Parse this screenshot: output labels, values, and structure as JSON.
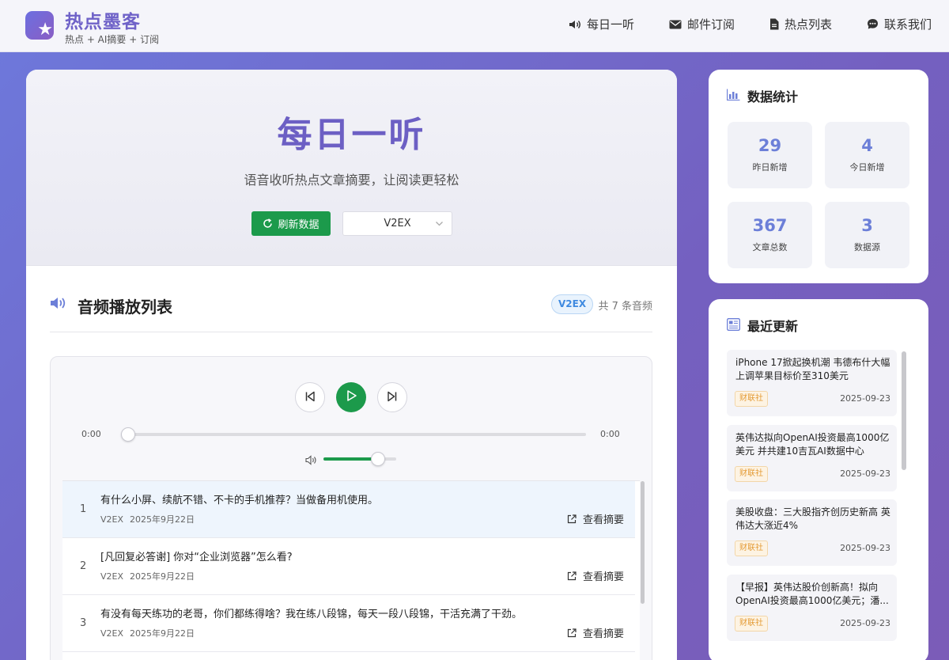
{
  "brand": {
    "title": "热点墨客",
    "subtitle": "热点 + AI摘要 + 订阅",
    "logo_icon": "star-icon"
  },
  "nav": [
    {
      "label": "每日一听",
      "icon": "speaker-icon"
    },
    {
      "label": "邮件订阅",
      "icon": "mail-icon"
    },
    {
      "label": "热点列表",
      "icon": "document-icon"
    },
    {
      "label": "联系我们",
      "icon": "chat-icon"
    }
  ],
  "hero": {
    "title": "每日一听",
    "subtitle": "语音收听热点文章摘要，让阅读更轻松",
    "refresh_label": "刷新数据",
    "source_select": "V2EX"
  },
  "playlist": {
    "title": "音频播放列表",
    "source_tag": "V2EX",
    "count_text": "共 7 条音频"
  },
  "player": {
    "current_time": "0:00",
    "total_time": "0:00",
    "progress": 0,
    "volume": 0.75
  },
  "tracks": [
    {
      "num": "1",
      "title": "有什么小屏、续航不错、不卡的手机推荐？当做备用机使用。",
      "source": "V2EX",
      "date": "2025年9月22日",
      "link": "查看摘要"
    },
    {
      "num": "2",
      "title": "[凡回复必答谢] 你对“企业浏览器”怎么看?",
      "source": "V2EX",
      "date": "2025年9月22日",
      "link": "查看摘要"
    },
    {
      "num": "3",
      "title": "有没有每天练功的老哥，你们都练得啥？我在练八段锦，每天一段八段锦，干活充满了干劲。",
      "source": "V2EX",
      "date": "2025年9月22日",
      "link": "查看摘要"
    }
  ],
  "stats": {
    "title": "数据统计",
    "items": [
      {
        "value": "29",
        "label": "昨日新增"
      },
      {
        "value": "4",
        "label": "今日新增"
      },
      {
        "value": "367",
        "label": "文章总数"
      },
      {
        "value": "3",
        "label": "数据源"
      }
    ]
  },
  "recent": {
    "title": "最近更新",
    "items": [
      {
        "title": "iPhone 17掀起换机潮 韦德布什大幅上调苹果目标价至310美元",
        "tag": "财联社",
        "date": "2025-09-23"
      },
      {
        "title": "英伟达拟向OpenAI投资最高1000亿美元 并共建10吉瓦AI数据中心",
        "tag": "财联社",
        "date": "2025-09-23"
      },
      {
        "title": "美股收盘：三大股指齐创历史新高 英伟达大涨近4%",
        "tag": "财联社",
        "date": "2025-09-23"
      },
      {
        "title": "【早报】英伟达股价创新高！拟向OpenAI投资最高1000亿美元；潘...",
        "tag": "财联社",
        "date": "2025-09-23"
      }
    ]
  },
  "colors": {
    "accent_purple": "#6c5fc4",
    "accent_green": "#1c9a4b",
    "stat_blue": "#6c7fd8",
    "tag_orange": "#e49b35"
  }
}
